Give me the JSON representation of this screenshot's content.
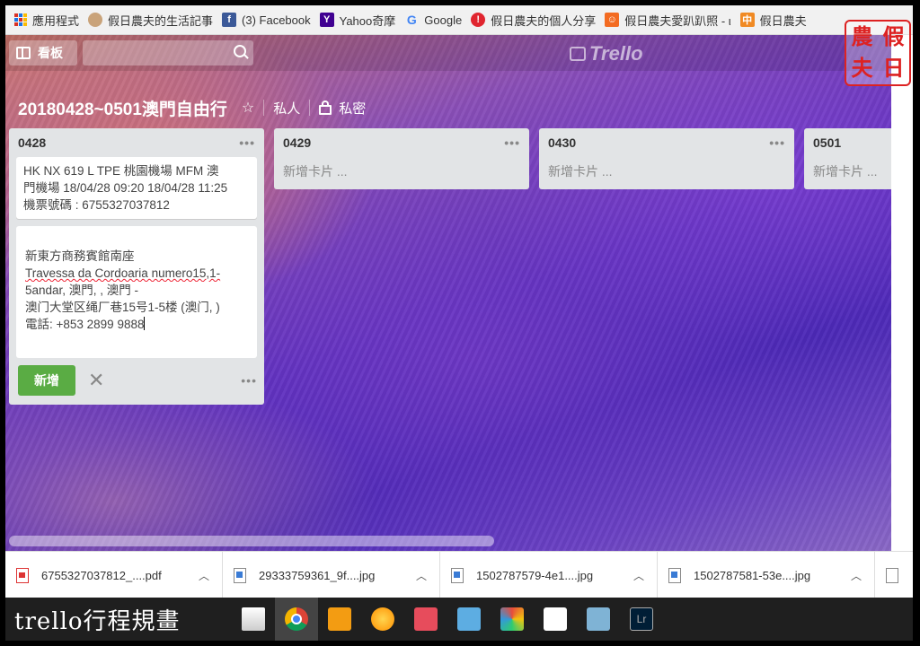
{
  "bookmarks": [
    {
      "label": "應用程式",
      "icon": "apps-grid-icon"
    },
    {
      "label": "假日農夫的生活記事",
      "icon": "farmer-avatar-icon"
    },
    {
      "label": "(3) Facebook",
      "icon": "facebook-icon"
    },
    {
      "label": "Yahoo奇摩",
      "icon": "yahoo-icon"
    },
    {
      "label": "Google",
      "icon": "google-icon"
    },
    {
      "label": "假日農夫的個人分享",
      "icon": "pixnet-icon"
    },
    {
      "label": "假日農夫愛趴趴照 - ι",
      "icon": "blog-icon"
    },
    {
      "label": "假日農夫",
      "icon": "zhong-icon"
    }
  ],
  "header": {
    "boards_label": "看板",
    "search_placeholder": "",
    "logo": "Trello",
    "board_title": "20180428~0501澳門自由行",
    "visibility_private": "私人",
    "visibility_secret": "私密"
  },
  "lists": [
    {
      "title": "0428",
      "cards": [
        [
          "HK NX 619 L TPE 桃園機場 MFM 澳",
          "門機場 18/04/28 09:20 18/04/28 11:25",
          "機票號碼 : 6755327037812"
        ]
      ],
      "edit_lines": [
        "新東方商務賓館南座",
        "Travessa da Cordoaria numero15,1-",
        "5andar, 澳門, , 澳門 -",
        "澳门大堂区绳厂巷15号1-5楼 (澳门, )",
        "電話: +853 2899 9888"
      ],
      "add_button": "新增"
    },
    {
      "title": "0429",
      "add_card": "新增卡片 ..."
    },
    {
      "title": "0430",
      "add_card": "新增卡片 ..."
    },
    {
      "title": "0501",
      "add_card": "新增卡片 ..."
    }
  ],
  "downloads": [
    {
      "name": "6755327037812_....pdf",
      "type": "pdf"
    },
    {
      "name": "29333759361_9f....jpg",
      "type": "jpg"
    },
    {
      "name": "1502787579-4e1....jpg",
      "type": "jpg"
    },
    {
      "name": "1502787581-53e....jpg",
      "type": "jpg"
    }
  ],
  "taskbar": {
    "caption": "trello行程規畫",
    "apps": [
      "store-icon",
      "chrome-icon",
      "media-player-icon",
      "weather-icon",
      "photo-album-icon",
      "photo-viewer-icon",
      "paint-icon",
      "mail-icon",
      "remote-icon",
      "lightroom-icon"
    ]
  },
  "seal": {
    "chars": [
      "農",
      "假",
      "夫",
      "日"
    ]
  }
}
